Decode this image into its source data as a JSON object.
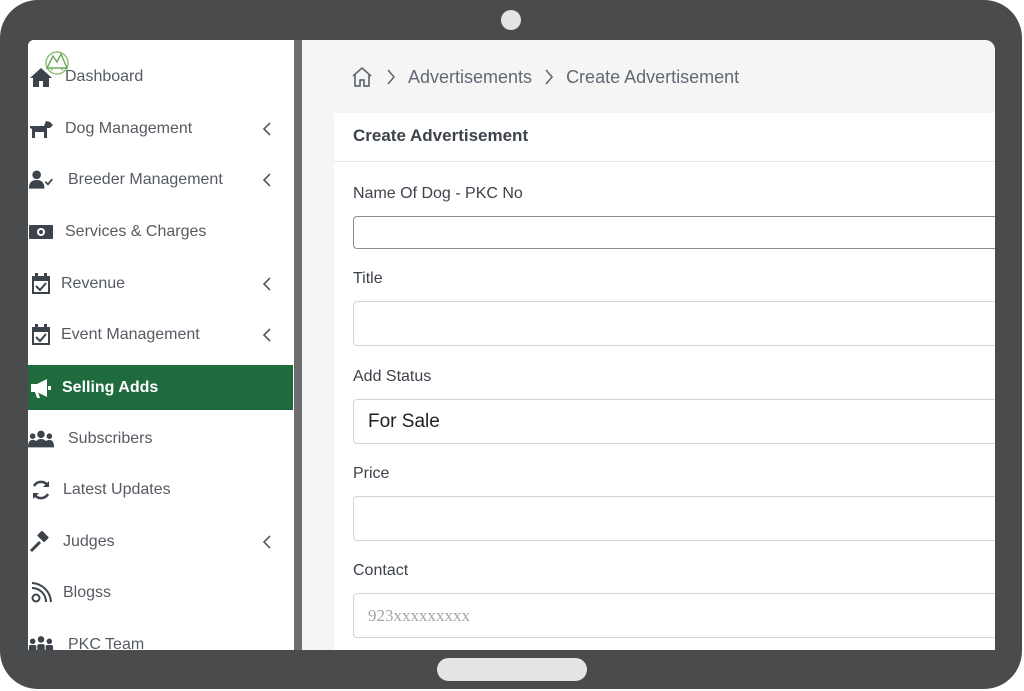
{
  "sidebar": {
    "items": [
      {
        "label": "Dashboard",
        "icon": "home-icon",
        "has_chevron": false,
        "active": false
      },
      {
        "label": "Dog Management",
        "icon": "dog-icon",
        "has_chevron": true,
        "active": false
      },
      {
        "label": "Breeder Management",
        "icon": "user-check-icon",
        "has_chevron": true,
        "active": false
      },
      {
        "label": "Services & Charges",
        "icon": "money-icon",
        "has_chevron": false,
        "active": false
      },
      {
        "label": "Revenue",
        "icon": "calendar-check-icon",
        "has_chevron": true,
        "active": false
      },
      {
        "label": "Event Management",
        "icon": "calendar-check-icon",
        "has_chevron": true,
        "active": false
      },
      {
        "label": "Selling Adds",
        "icon": "megaphone-icon",
        "has_chevron": false,
        "active": true
      },
      {
        "label": "Subscribers",
        "icon": "users-icon",
        "has_chevron": false,
        "active": false
      },
      {
        "label": "Latest Updates",
        "icon": "refresh-icon",
        "has_chevron": false,
        "active": false
      },
      {
        "label": "Judges",
        "icon": "gavel-icon",
        "has_chevron": true,
        "active": false
      },
      {
        "label": "Blogss",
        "icon": "rss-icon",
        "has_chevron": false,
        "active": false
      },
      {
        "label": "PKC Team",
        "icon": "team-icon",
        "has_chevron": false,
        "active": false
      }
    ]
  },
  "breadcrumb": {
    "home_icon": "home-outline-icon",
    "items": [
      "Advertisements",
      "Create Advertisement"
    ]
  },
  "card": {
    "title": "Create Advertisement"
  },
  "form": {
    "dog_name": {
      "label": "Name Of Dog - PKC No",
      "value": ""
    },
    "title": {
      "label": "Title",
      "value": ""
    },
    "status": {
      "label": "Add Status",
      "selected": "For Sale"
    },
    "price": {
      "label": "Price",
      "value": ""
    },
    "contact": {
      "label": "Contact",
      "placeholder": "923xxxxxxxxx"
    }
  },
  "colors": {
    "active_nav": "#1f6b3e",
    "device_frame": "#4a4b4d",
    "page_background": "#f5f5f5"
  }
}
